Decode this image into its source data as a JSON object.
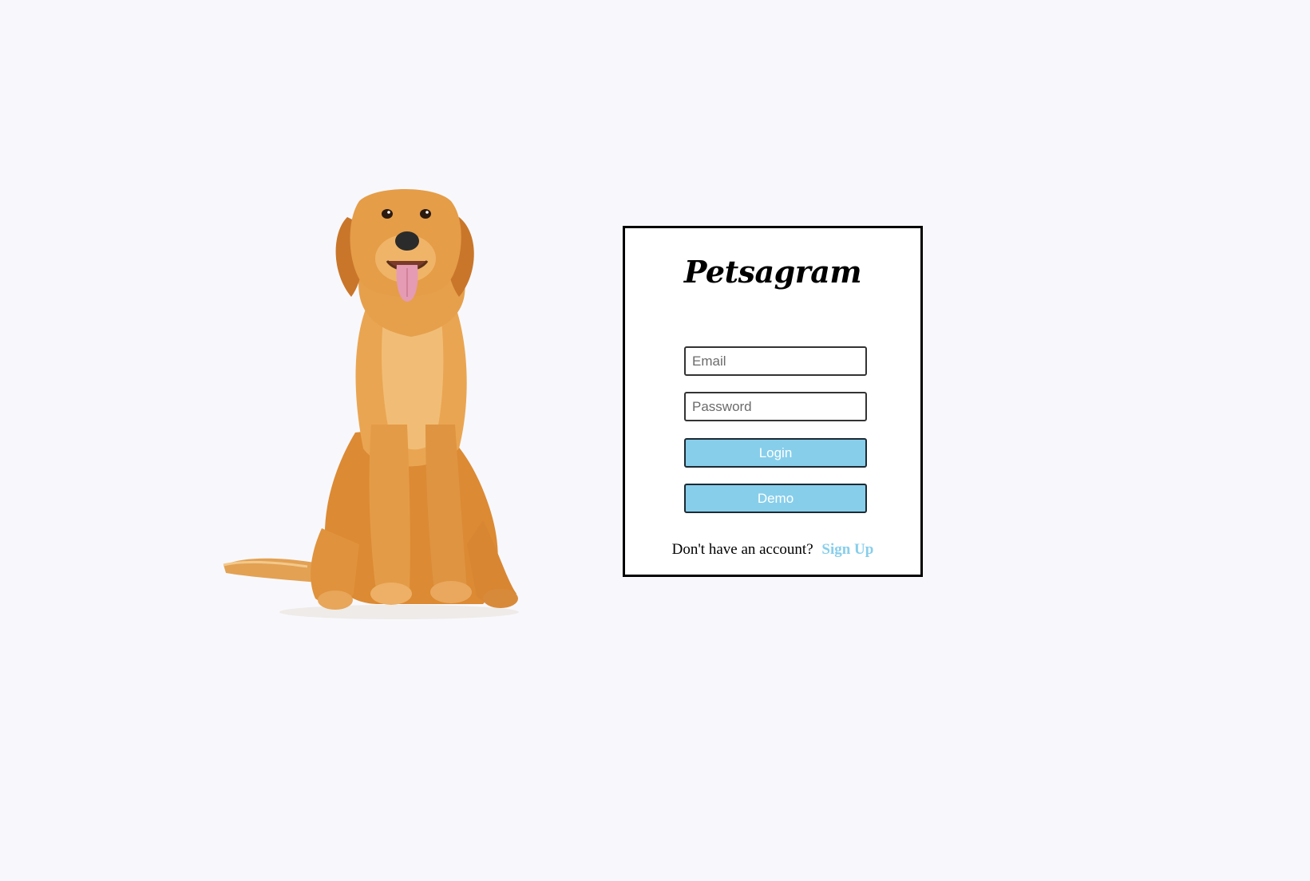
{
  "app": {
    "logo_text": "Petsagram"
  },
  "login_form": {
    "email_placeholder": "Email",
    "password_placeholder": "Password",
    "login_label": "Login",
    "demo_label": "Demo",
    "signup_prompt": "Don't have an account?",
    "signup_link": "Sign Up"
  },
  "hero": {
    "subject": "golden-retriever-dog"
  },
  "colors": {
    "page_background": "#f8f8fc",
    "card_background": "#ffffff",
    "card_border": "#000000",
    "accent": "#87ceeb",
    "button_text": "#ffffff"
  }
}
